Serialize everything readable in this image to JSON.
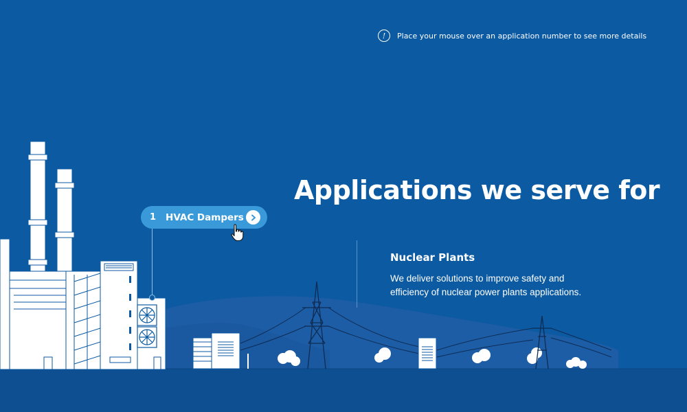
{
  "hint": {
    "icon": "info-icon",
    "glyph": "!",
    "text": "Place your mouse over an application number to see more details"
  },
  "headline": "Applications we serve for",
  "hotspot": {
    "number": "1",
    "label": "HVAC Dampers",
    "icon": "chevron-right-icon"
  },
  "industry": {
    "title": "Nuclear Plants",
    "description": "We deliver solutions to improve safety and efficiency of nuclear power plants applications."
  },
  "colors": {
    "background": "#0b5aa2",
    "hill": "#1d5da5",
    "ground": "#0d4f91",
    "pill": "#3a9ad9",
    "line_art": "#ffffff"
  }
}
